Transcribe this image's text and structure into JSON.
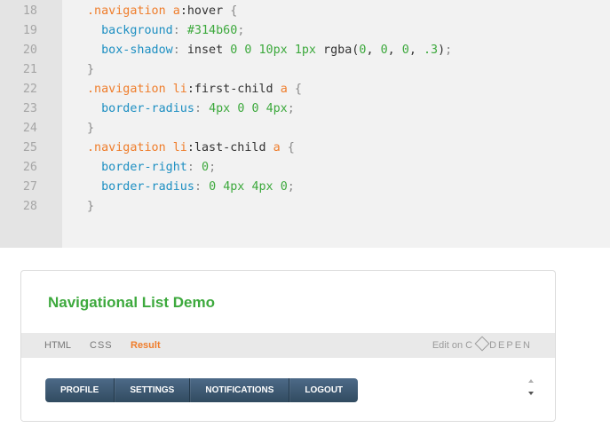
{
  "code": {
    "lines": [
      {
        "num": "18",
        "tokens": [
          {
            "c": "sel",
            "t": ".navigation "
          },
          {
            "c": "sel",
            "t": "a"
          },
          {
            "c": "plain",
            "t": ":hover "
          },
          {
            "c": "punc",
            "t": "{"
          }
        ]
      },
      {
        "num": "19",
        "tokens": [
          {
            "c": "plain",
            "t": "  "
          },
          {
            "c": "prop",
            "t": "background"
          },
          {
            "c": "punc",
            "t": ": "
          },
          {
            "c": "val",
            "t": "#314b60"
          },
          {
            "c": "punc",
            "t": ";"
          }
        ]
      },
      {
        "num": "20",
        "tokens": [
          {
            "c": "plain",
            "t": "  "
          },
          {
            "c": "prop",
            "t": "box-shadow"
          },
          {
            "c": "punc",
            "t": ": "
          },
          {
            "c": "plain",
            "t": "inset "
          },
          {
            "c": "val",
            "t": "0"
          },
          {
            "c": "plain",
            "t": " "
          },
          {
            "c": "val",
            "t": "0"
          },
          {
            "c": "plain",
            "t": " "
          },
          {
            "c": "val",
            "t": "10px"
          },
          {
            "c": "plain",
            "t": " "
          },
          {
            "c": "val",
            "t": "1px"
          },
          {
            "c": "plain",
            "t": " rgba("
          },
          {
            "c": "val",
            "t": "0"
          },
          {
            "c": "plain",
            "t": ", "
          },
          {
            "c": "val",
            "t": "0"
          },
          {
            "c": "plain",
            "t": ", "
          },
          {
            "c": "val",
            "t": "0"
          },
          {
            "c": "plain",
            "t": ", "
          },
          {
            "c": "val",
            "t": ".3"
          },
          {
            "c": "plain",
            "t": ")"
          },
          {
            "c": "punc",
            "t": ";"
          }
        ]
      },
      {
        "num": "21",
        "tokens": [
          {
            "c": "punc",
            "t": "}"
          }
        ]
      },
      {
        "num": "22",
        "tokens": [
          {
            "c": "sel",
            "t": ".navigation "
          },
          {
            "c": "sel",
            "t": "li"
          },
          {
            "c": "plain",
            "t": ":first-child "
          },
          {
            "c": "sel",
            "t": "a"
          },
          {
            "c": "plain",
            "t": " "
          },
          {
            "c": "punc",
            "t": "{"
          }
        ]
      },
      {
        "num": "23",
        "tokens": [
          {
            "c": "plain",
            "t": "  "
          },
          {
            "c": "prop",
            "t": "border-radius"
          },
          {
            "c": "punc",
            "t": ": "
          },
          {
            "c": "val",
            "t": "4px"
          },
          {
            "c": "plain",
            "t": " "
          },
          {
            "c": "val",
            "t": "0"
          },
          {
            "c": "plain",
            "t": " "
          },
          {
            "c": "val",
            "t": "0"
          },
          {
            "c": "plain",
            "t": " "
          },
          {
            "c": "val",
            "t": "4px"
          },
          {
            "c": "punc",
            "t": ";"
          }
        ]
      },
      {
        "num": "24",
        "tokens": [
          {
            "c": "punc",
            "t": "}"
          }
        ]
      },
      {
        "num": "25",
        "tokens": [
          {
            "c": "sel",
            "t": ".navigation "
          },
          {
            "c": "sel",
            "t": "li"
          },
          {
            "c": "plain",
            "t": ":last-child "
          },
          {
            "c": "sel",
            "t": "a"
          },
          {
            "c": "plain",
            "t": " "
          },
          {
            "c": "punc",
            "t": "{"
          }
        ]
      },
      {
        "num": "26",
        "tokens": [
          {
            "c": "plain",
            "t": "  "
          },
          {
            "c": "prop",
            "t": "border-right"
          },
          {
            "c": "punc",
            "t": ": "
          },
          {
            "c": "val",
            "t": "0"
          },
          {
            "c": "punc",
            "t": ";"
          }
        ]
      },
      {
        "num": "27",
        "tokens": [
          {
            "c": "plain",
            "t": "  "
          },
          {
            "c": "prop",
            "t": "border-radius"
          },
          {
            "c": "punc",
            "t": ": "
          },
          {
            "c": "val",
            "t": "0"
          },
          {
            "c": "plain",
            "t": " "
          },
          {
            "c": "val",
            "t": "4px"
          },
          {
            "c": "plain",
            "t": " "
          },
          {
            "c": "val",
            "t": "4px"
          },
          {
            "c": "plain",
            "t": " "
          },
          {
            "c": "val",
            "t": "0"
          },
          {
            "c": "punc",
            "t": ";"
          }
        ]
      },
      {
        "num": "28",
        "tokens": [
          {
            "c": "punc",
            "t": "}"
          }
        ]
      }
    ]
  },
  "embed": {
    "title": "Navigational List Demo",
    "tabs": {
      "html": "HTML",
      "css": "CSS",
      "result": "Result"
    },
    "edit_prefix": "Edit on",
    "edit_brand_a": "C",
    "edit_brand_b": "DEPEN",
    "nav_items": [
      "PROFILE",
      "SETTINGS",
      "NOTIFICATIONS",
      "LOGOUT"
    ]
  },
  "colors": {
    "selector": "#ef7d2b",
    "property": "#1d8fc2",
    "value": "#3da93d",
    "title_green": "#3da93d",
    "active_tab": "#ef7d2b",
    "nav_bg": "#314b60"
  },
  "icons": {
    "logo": "codepen-logo-icon",
    "scroll_up": "scroll-up-icon",
    "scroll_down": "scroll-down-icon"
  }
}
